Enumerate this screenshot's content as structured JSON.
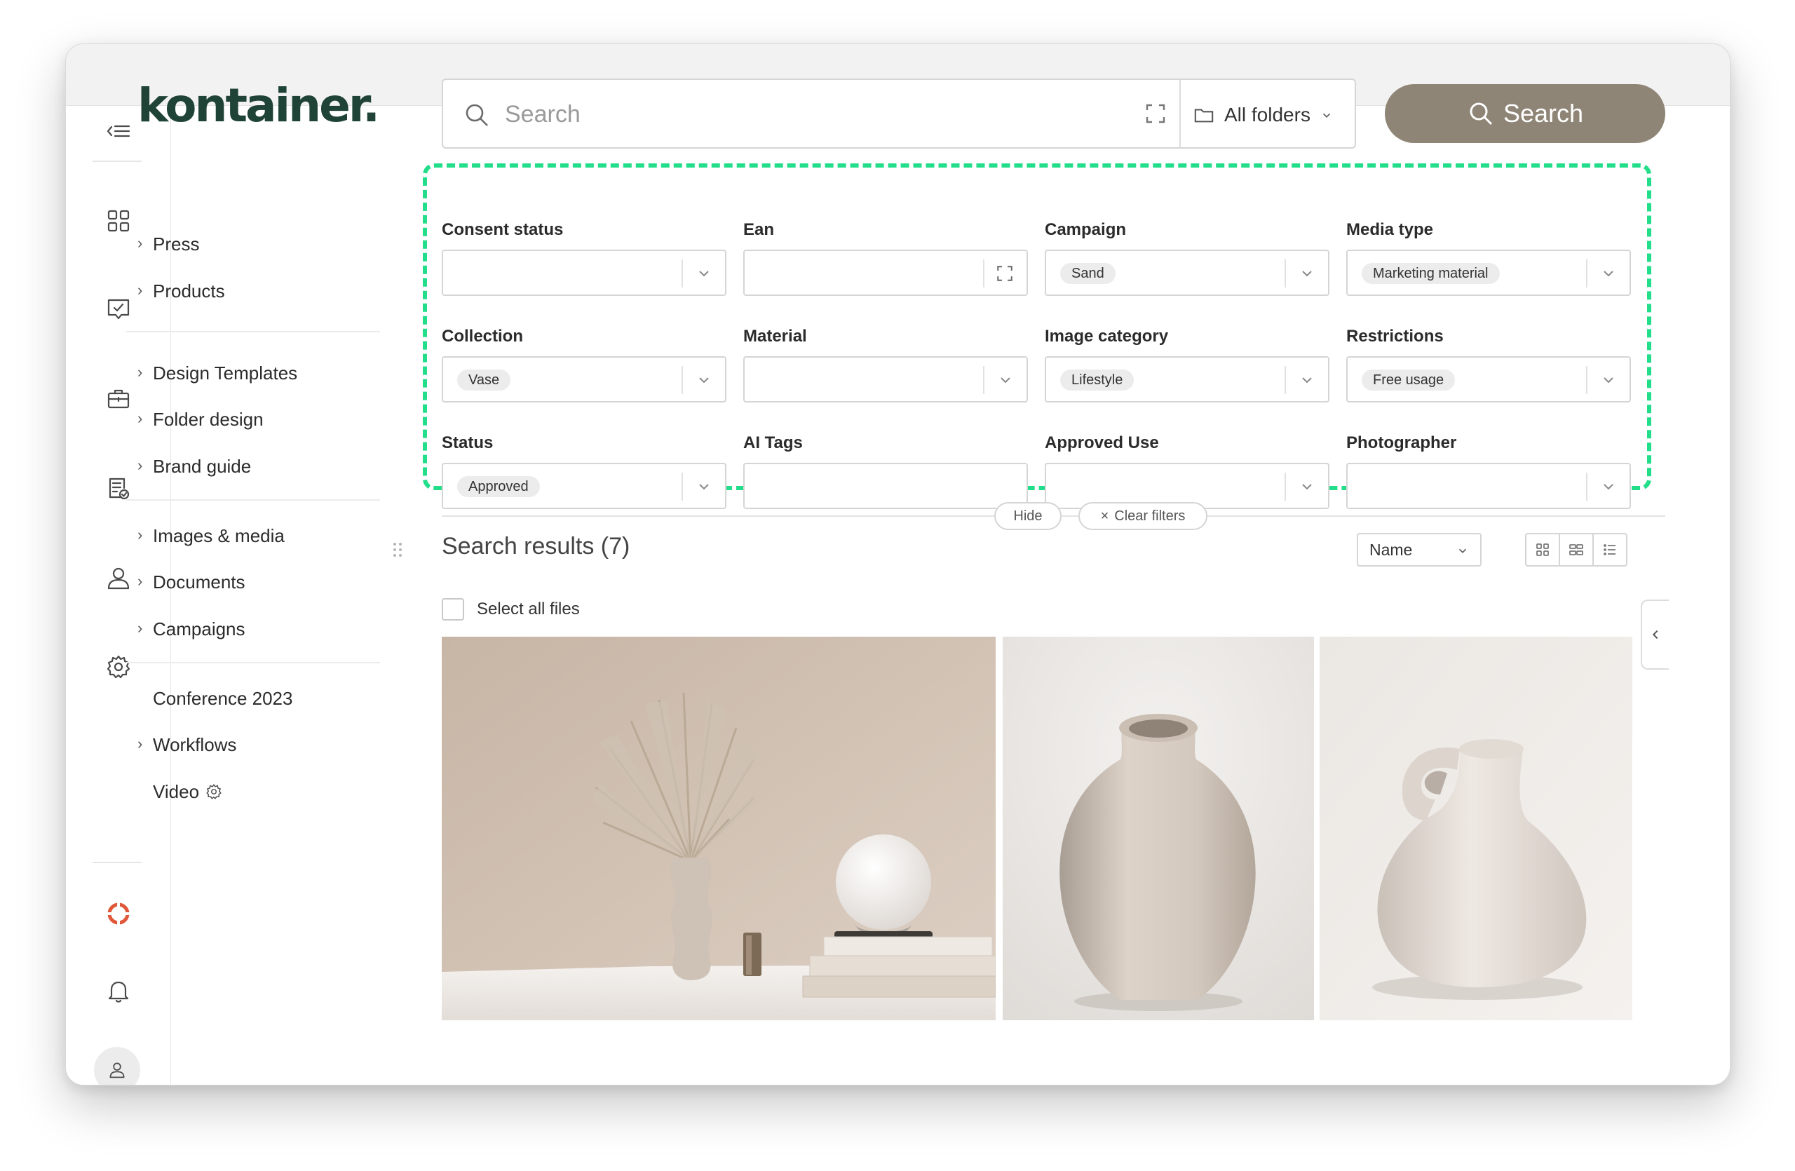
{
  "brand": {
    "logo_text": "kontainer.",
    "logo_color": "#1f4336",
    "accent": "#8f8576",
    "filter_highlight": "#22dd8a"
  },
  "rail": {
    "icons": [
      "menu-collapse-icon",
      "dashboard-icon",
      "approval-icon",
      "briefcase-icon",
      "document-check-icon",
      "user-icon",
      "settings-icon",
      "help-lifebuoy-icon",
      "bell-icon",
      "avatar-icon"
    ]
  },
  "nav": {
    "group1": [
      {
        "label": "Press",
        "chevron": true
      },
      {
        "label": "Products",
        "chevron": true
      }
    ],
    "group2": [
      {
        "label": "Design Templates",
        "chevron": true
      },
      {
        "label": "Folder design",
        "chevron": true
      },
      {
        "label": "Brand guide",
        "chevron": true
      }
    ],
    "group3": [
      {
        "label": "Images & media",
        "chevron": true
      },
      {
        "label": "Documents",
        "chevron": true
      },
      {
        "label": "Campaigns",
        "chevron": true
      }
    ],
    "group4": [
      {
        "label": "Conference 2023",
        "chevron": false
      },
      {
        "label": "Workflows",
        "chevron": true
      },
      {
        "label": "Video",
        "chevron": false
      }
    ]
  },
  "search": {
    "placeholder": "Search",
    "value": "",
    "folders_label": "All folders",
    "button_label": "Search"
  },
  "filters": {
    "consent_status": {
      "label": "Consent status",
      "value": ""
    },
    "ean": {
      "label": "Ean",
      "value": ""
    },
    "campaign": {
      "label": "Campaign",
      "value": "Sand"
    },
    "media_type": {
      "label": "Media type",
      "value": "Marketing material"
    },
    "collection": {
      "label": "Collection",
      "value": "Vase"
    },
    "material": {
      "label": "Material",
      "value": ""
    },
    "image_category": {
      "label": "Image category",
      "value": "Lifestyle"
    },
    "restrictions": {
      "label": "Restrictions",
      "value": "Free usage"
    },
    "status": {
      "label": "Status",
      "value": "Approved"
    },
    "ai_tags": {
      "label": "AI Tags",
      "value": ""
    },
    "approved_use": {
      "label": "Approved Use",
      "value": ""
    },
    "photographer": {
      "label": "Photographer",
      "value": ""
    }
  },
  "filter_actions": {
    "hide": "Hide",
    "clear": "Clear filters"
  },
  "results": {
    "title": "Search results (7)",
    "sort_by": "Name",
    "select_all": "Select all files",
    "views": [
      "grid-large-icon",
      "grid-small-icon",
      "list-view-icon"
    ]
  }
}
